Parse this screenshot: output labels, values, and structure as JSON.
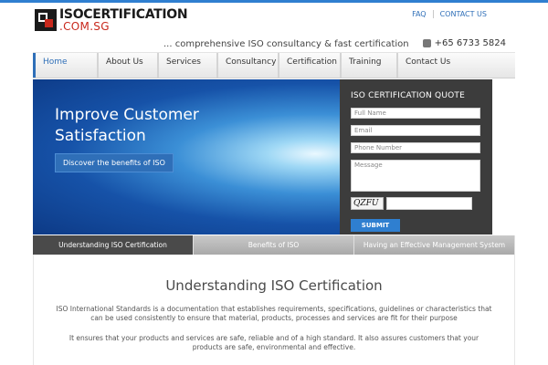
{
  "logo": {
    "line1": "ISOCERTIFICATION",
    "line2": ".COM.SG"
  },
  "toplinks": [
    "FAQ",
    "CONTACT US"
  ],
  "tagline": "... comprehensive ISO consultancy & fast certification",
  "phone": "+65 6733 5824",
  "nav": [
    {
      "label": "Home",
      "active": true
    },
    {
      "label": "About Us"
    },
    {
      "label": "Services"
    },
    {
      "label": "Consultancy"
    },
    {
      "label": "Certification"
    },
    {
      "label": "Training"
    },
    {
      "label": "Contact Us"
    }
  ],
  "hero": {
    "title": "Improve Customer Satisfaction",
    "button": "Discover the benefits of ISO"
  },
  "quote": {
    "title": "ISO CERTIFICATION QUOTE",
    "name_placeholder": "Full Name",
    "email_placeholder": "Email",
    "phone_placeholder": "Phone Number",
    "message_placeholder": "Message",
    "captcha_text": "QZFU",
    "submit": "SUBMIT"
  },
  "tabs": [
    {
      "label": "Understanding ISO Certification",
      "active": true
    },
    {
      "label": "Benefits of ISO"
    },
    {
      "label": "Having an Effective Management System"
    }
  ],
  "content": {
    "title": "Understanding ISO Certification",
    "para1": "ISO International Standards is a documentation that establishes requirements, specifications, guidelines or characteristics that can be used consistently to ensure that material, products, processes and services are fit for their purpose",
    "para2": "It ensures that your products and services are safe, reliable and of a high standard. It also assures customers that your products are safe, environmental and effective."
  },
  "colors": {
    "accent": "#2f6fb8",
    "brand_red": "#c8281c",
    "form_bg": "#3c3c3c"
  },
  "icons": {
    "phone": "phone-icon"
  }
}
